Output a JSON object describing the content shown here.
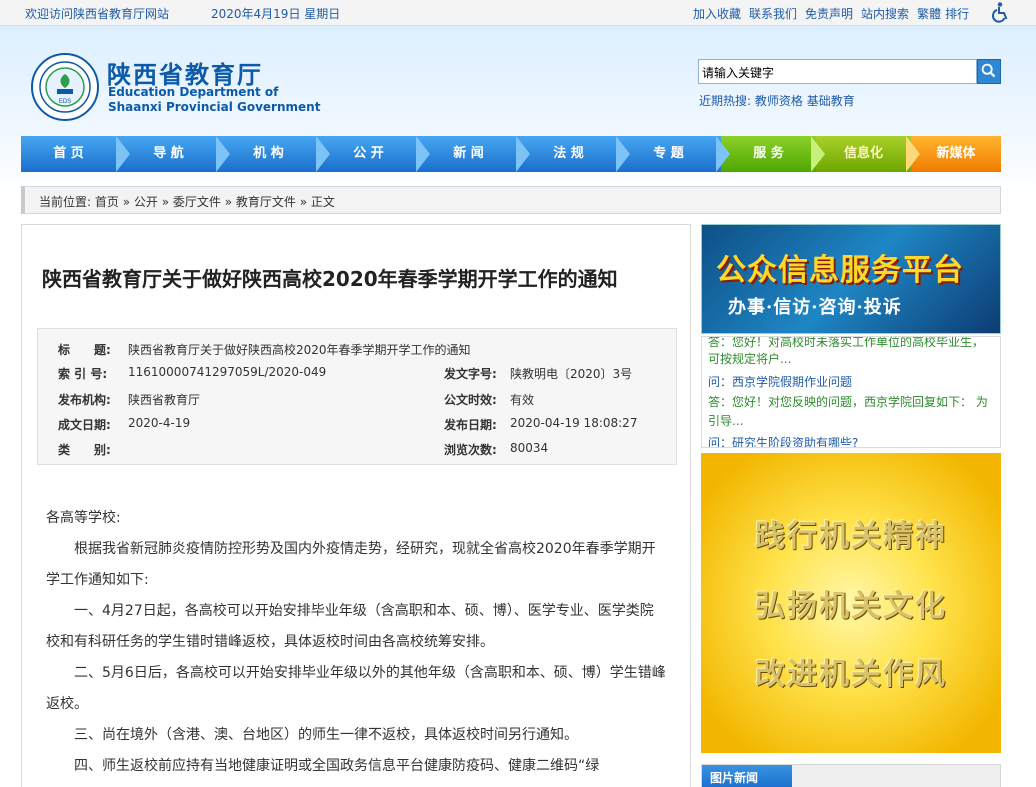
{
  "topbar": {
    "welcome": "欢迎访问陕西省教育厅网站",
    "date": "2020年4月19日 星期日",
    "links": [
      "加入收藏",
      "联系我们",
      "免责声明",
      "站内搜索",
      "繁體",
      "排行"
    ]
  },
  "header": {
    "site_cn": "陕西省教育厅",
    "site_en1": "Education Department of",
    "site_en2": "Shaanxi Provincial Government",
    "logo_center": "EDS"
  },
  "search": {
    "placeholder": "请输入关键字",
    "hot_label": "近期热搜:",
    "hot_words": [
      "教师资格",
      "基础教育"
    ]
  },
  "nav": {
    "items": [
      "首 页",
      "导 航",
      "机 构",
      "公 开",
      "新 闻",
      "法 规",
      "专 题",
      "服 务",
      "信息化",
      "新媒体"
    ]
  },
  "breadcrumb": {
    "prefix": "当前位置: ",
    "items": [
      "首页",
      "公开",
      "委厅文件",
      "教育厅文件",
      "正文"
    ],
    "sep": " » "
  },
  "article": {
    "title": "陕西省教育厅关于做好陕西高校2020年春季学期开学工作的通知",
    "meta": {
      "title_label": "标　　题:",
      "title_value": "陕西省教育厅关于做好陕西高校2020年春季学期开学工作的通知",
      "index_label": "索 引 号:",
      "index_value": "11610000741297059L/2020-049",
      "doc_no_label": "发文字号:",
      "doc_no_value": "陕教明电〔2020〕3号",
      "publisher_label": "发布机构:",
      "publisher_value": "陕西省教育厅",
      "validity_label": "公文时效:",
      "validity_value": "有效",
      "created_label": "成文日期:",
      "created_value": "2020-4-19",
      "published_label": "发布日期:",
      "published_value": "2020-04-19 18:08:27",
      "category_label": "类　　别:",
      "category_value": "",
      "views_label": "浏览次数:",
      "views_value": "80034"
    },
    "paragraphs": [
      "各高等学校:",
      "根据我省新冠肺炎疫情防控形势及国内外疫情走势，经研究，现就全省高校2020年春季学期开学工作通知如下:",
      "一、4月27日起，各高校可以开始安排毕业年级（含高职和本、硕、博）、医学专业、医学类院校和有科研任务的学生错时错峰返校，具体返校时间由各高校统筹安排。",
      "二、5月6日后，各高校可以开始安排毕业年级以外的其他年级（含高职和本、硕、博）学生错峰返校。",
      "三、尚在境外（含港、澳、台地区）的师生一律不返校，具体返校时间另行通知。",
      "四、师生返校前应持有当地健康证明或全国政务信息平台健康防疫码、健康二维码“绿"
    ]
  },
  "sidebar": {
    "banner1_title": "公众信息服务平台",
    "banner1_sub": "办事·信访·咨询·投诉",
    "qa": [
      {
        "type": "a",
        "text": "答：您好！对高校时未落实工作单位的高校毕业生，"
      },
      {
        "type": "a",
        "text": "可按规定将户..."
      },
      {
        "type": "q",
        "text": "问：西京学院假期作业问题"
      },
      {
        "type": "a",
        "text": "答：您好！对您反映的问题，西京学院回复如下： 为"
      },
      {
        "type": "a",
        "text": "引导..."
      },
      {
        "type": "q",
        "text": "问：研究生阶段资助有哪些?"
      }
    ],
    "slogans": [
      "践行机关精神",
      "弘扬机关文化",
      "改进机关作风"
    ],
    "pic_news": "图片新闻"
  },
  "colors": {
    "brand_blue": "#0c5aa8",
    "nav_blue": "#1a6fcd",
    "nav_green": "#5cb800",
    "nav_orange": "#f39c12"
  }
}
